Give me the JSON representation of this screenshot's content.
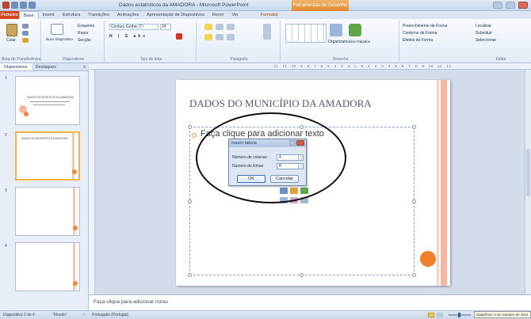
{
  "window": {
    "title": "Dados estatísticos da AMADORA - Microsoft PowerPoint",
    "contextual_tab": "Ferramentas de Desenho"
  },
  "ribbon_tabs": [
    "Ficheiro",
    "Base",
    "Inserir",
    "Estrutura",
    "Transições",
    "Animações",
    "Apresentação de Diapositivos",
    "Rever",
    "Ver",
    "Formatar"
  ],
  "ribbon": {
    "groups": [
      "Área de Transferência",
      "Diapositivos",
      "Tipo de letra",
      "Parágrafo",
      "Desenho",
      "Editar"
    ],
    "paste_label": "Colar",
    "new_slide_label": "Novo Diapositivo",
    "layout_label": "Esquema",
    "reset_label": "Repor",
    "section_label": "Secção",
    "font_name": "Century Gothic (Tí",
    "font_size": "24",
    "arrange_label": "Organizar",
    "quick_styles_label": "Estilos Rápidos",
    "shape_fill_label": "Preenchimento da Forma",
    "shape_outline_label": "Contorno da Forma",
    "shape_effects_label": "Efeitos de Forma",
    "find_label": "Localizar",
    "replace_label": "Substituir",
    "select_label": "Seleccionar"
  },
  "left_pane": {
    "tabs": [
      "Diapositivos",
      "Destaques"
    ],
    "close": "x",
    "slides": [
      {
        "number": "1",
        "title": "DADOS ESTATÍSTICOS DA AMADORA",
        "selected": false
      },
      {
        "number": "2",
        "title": "DADOS DO MUNICÍPIO DA AMADORA",
        "selected": true
      },
      {
        "number": "3",
        "title": "",
        "selected": false
      },
      {
        "number": "4",
        "title": "",
        "selected": false
      }
    ]
  },
  "slide": {
    "title": "DADOS DO MUNICÍPIO DA AMADORA",
    "placeholder_text": "Faça clique para adicionar texto"
  },
  "dialog": {
    "title": "Inserir tabela",
    "columns_label": "Número de colunas:",
    "columns_value": "4",
    "rows_label": "Número de linhas:",
    "rows_value": "8",
    "ok_label": "OK",
    "cancel_label": "Cancelar"
  },
  "notes": {
    "placeholder": "Faça clique para adicionar notas"
  },
  "status_bar": {
    "slide_position": "Diapositivo 2 de 4",
    "theme": "\"Mundo\"",
    "language": "Português (Portugal)",
    "tooltip": "Data/hora: 4 de Outubro de 2011"
  },
  "colors": {
    "accent_orange": "#f07f2d",
    "file_tab": "#d2451e",
    "slide_stripe": "#f4b8a2"
  }
}
